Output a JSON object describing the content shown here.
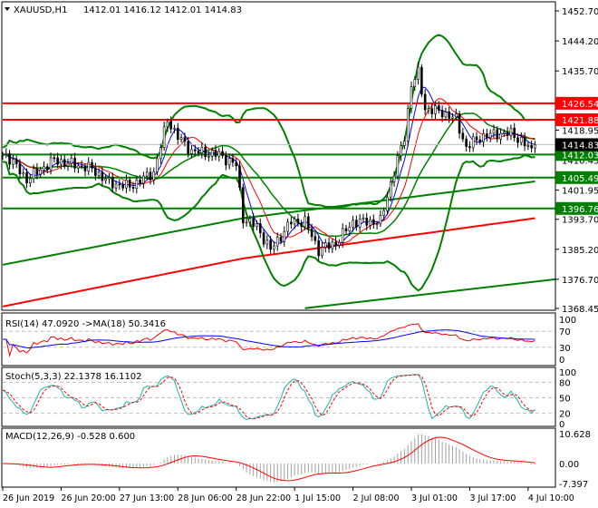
{
  "header": {
    "symbol_label": "XAUUSD,H1",
    "ohlc": "1412.01 1416.12 1412.01 1414.83"
  },
  "chart_data": {
    "type": "candlestick",
    "symbol": "XAUUSD",
    "timeframe": "H1",
    "ylim": [
      1368.45,
      1452.7
    ],
    "price_ticks": [
      "1452.70",
      "1444.20",
      "1435.70",
      "1418.95",
      "1410.45",
      "1401.95",
      "1393.70",
      "1385.20",
      "1376.70",
      "1368.45"
    ],
    "time_labels": [
      "26 Jun 2019",
      "26 Jun 20:00",
      "27 Jun 13:00",
      "28 Jun 06:00",
      "28 Jun 22:00",
      "1 Jul 15:00",
      "2 Jul 08:00",
      "3 Jul 01:00",
      "3 Jul 17:00",
      "4 Jul 10:00"
    ],
    "time_label_bar_index": [
      0,
      17,
      34,
      51,
      68,
      85,
      102,
      119,
      136,
      153
    ],
    "bar_count": 156,
    "key_closes": [
      [
        0,
        1412
      ],
      [
        1,
        1412
      ],
      [
        7,
        1405
      ],
      [
        15,
        1410.5
      ],
      [
        26,
        1408
      ],
      [
        31,
        1404
      ],
      [
        37,
        1403
      ],
      [
        44,
        1407
      ],
      [
        48,
        1422
      ],
      [
        51,
        1417
      ],
      [
        55,
        1413
      ],
      [
        63,
        1412
      ],
      [
        68,
        1409
      ],
      [
        70,
        1394
      ],
      [
        74,
        1391.6
      ],
      [
        78,
        1385
      ],
      [
        84,
        1393
      ],
      [
        88,
        1393
      ],
      [
        92,
        1385
      ],
      [
        97,
        1387
      ],
      [
        102,
        1393
      ],
      [
        110,
        1393
      ],
      [
        113,
        1404
      ],
      [
        117,
        1417
      ],
      [
        119,
        1432
      ],
      [
        121,
        1435
      ],
      [
        123,
        1425
      ],
      [
        128,
        1424
      ],
      [
        132,
        1422
      ],
      [
        135,
        1414
      ],
      [
        139,
        1417
      ],
      [
        144,
        1418
      ],
      [
        148,
        1418
      ],
      [
        151,
        1416
      ],
      [
        154,
        1413
      ],
      [
        155,
        1414.83
      ]
    ],
    "current_price": "1414.83",
    "levels": [
      {
        "price": "1426.54",
        "color": "#ff0000"
      },
      {
        "price": "1421.88",
        "color": "#ff0000"
      },
      {
        "price": "1412.03",
        "color": "#008000"
      },
      {
        "price": "1405.49",
        "color": "#008000"
      },
      {
        "price": "1396.76",
        "color": "#008000"
      }
    ],
    "long_ma_green": [
      [
        0,
        1380.8
      ],
      [
        70,
        1394
      ],
      [
        155,
        1404.4
      ]
    ],
    "long_ma_red": [
      [
        0,
        1369
      ],
      [
        70,
        1382.6
      ],
      [
        155,
        1394
      ]
    ],
    "trend_line_green": [
      [
        88,
        1368.5
      ],
      [
        160,
        1376.7
      ]
    ],
    "bollinger": {
      "period": 20,
      "dev": 2
    },
    "indicators": {
      "rsi": {
        "label": "RSI(14) 47.0920  ->MA(18) 50.3416",
        "ticks": [
          "100",
          "70",
          "30",
          "0"
        ]
      },
      "stoch": {
        "label": "Stoch(5,3,3) 22.1378 16.1102",
        "ticks": [
          "100",
          "80",
          "50",
          "20",
          "0"
        ]
      },
      "macd": {
        "label": "MACD(12,26,9) -0.528 0.600",
        "ticks": [
          "10.628",
          "0.00",
          "-7.397"
        ],
        "ylim": [
          -7.397,
          10.628
        ]
      }
    }
  }
}
